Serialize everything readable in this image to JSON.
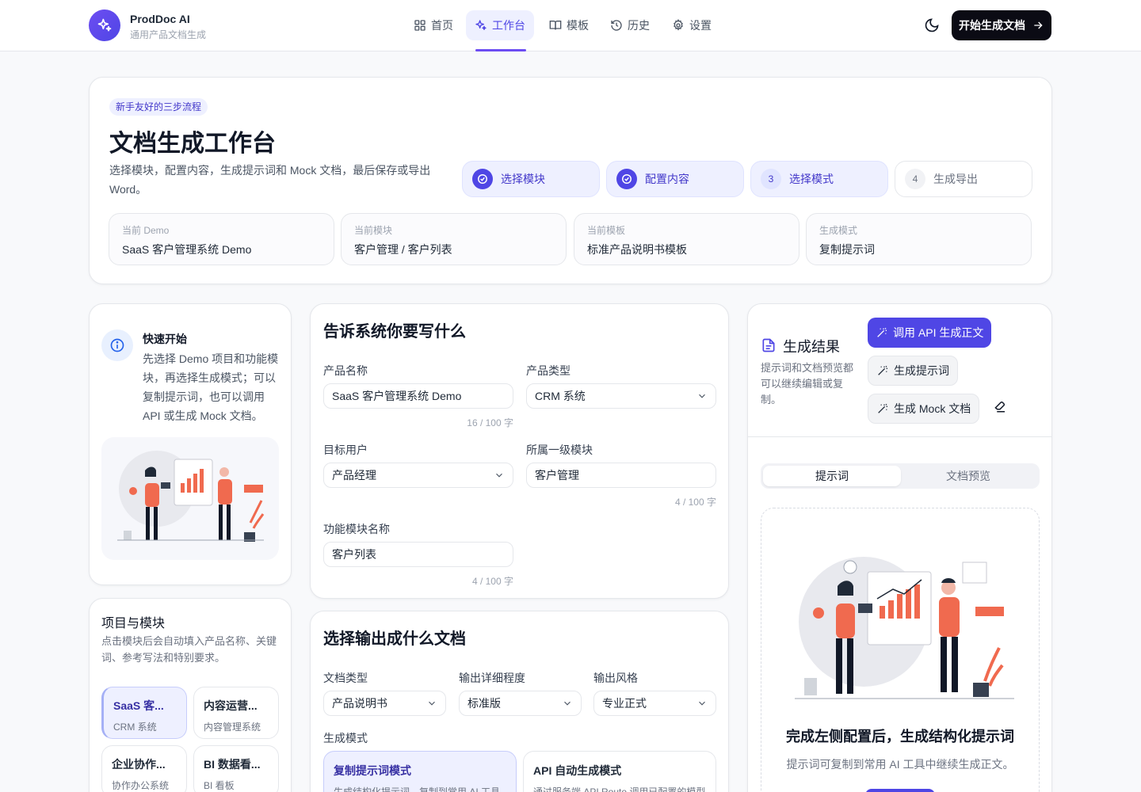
{
  "header": {
    "brand": "ProdDoc AI",
    "brand_sub": "通用产品文档生成",
    "nav": [
      {
        "label": "首页",
        "icon": "grid-icon"
      },
      {
        "label": "工作台",
        "icon": "sparkles-icon",
        "active": true
      },
      {
        "label": "模板",
        "icon": "book-icon"
      },
      {
        "label": "历史",
        "icon": "history-icon"
      },
      {
        "label": "设置",
        "icon": "gear-icon"
      }
    ],
    "cta": "开始生成文档"
  },
  "hero": {
    "badge": "新手友好的三步流程",
    "title": "文档生成工作台",
    "desc": "选择模块，配置内容，生成提示词和 Mock 文档，最后保存或导出 Word。",
    "steps": [
      {
        "label": "选择模块",
        "state": "done"
      },
      {
        "label": "配置内容",
        "state": "done"
      },
      {
        "num": "3",
        "label": "选择模式",
        "state": "current"
      },
      {
        "num": "4",
        "label": "生成导出",
        "state": "todo"
      }
    ],
    "info": [
      {
        "k": "当前 Demo",
        "v": "SaaS 客户管理系统 Demo"
      },
      {
        "k": "当前模块",
        "v": "客户管理 / 客户列表"
      },
      {
        "k": "当前模板",
        "v": "标准产品说明书模板"
      },
      {
        "k": "生成模式",
        "v": "复制提示词"
      }
    ]
  },
  "quick": {
    "title": "快速开始",
    "body": "先选择 Demo 项目和功能模块，再选择生成模式；可以复制提示词，也可以调用 API 或生成 Mock 文档。"
  },
  "projects": {
    "title": "项目与模块",
    "desc": "点击模块后会自动填入产品名称、关键词、参考写法和特别要求。",
    "items": [
      {
        "t": "SaaS 客...",
        "s": "CRM 系统",
        "selected": true
      },
      {
        "t": "内容运营...",
        "s": "内容管理系统"
      },
      {
        "t": "企业协作...",
        "s": "协作办公系统"
      },
      {
        "t": "BI 数据看...",
        "s": "BI 看板"
      }
    ]
  },
  "form": {
    "title": "告诉系统你要写什么",
    "product_name_label": "产品名称",
    "product_name": "SaaS 客户管理系统 Demo",
    "product_name_count": "16 / 100 字",
    "product_type_label": "产品类型",
    "product_type": "CRM 系统",
    "target_user_label": "目标用户",
    "target_user": "产品经理",
    "module_label": "所属一级模块",
    "module": "客户管理",
    "module_count": "4 / 100 字",
    "feature_label": "功能模块名称",
    "feature": "客户列表",
    "feature_count": "4 / 100 字"
  },
  "output": {
    "title": "选择输出成什么文档",
    "doc_type_label": "文档类型",
    "doc_type": "产品说明书",
    "detail_label": "输出详细程度",
    "detail": "标准版",
    "style_label": "输出风格",
    "style": "专业正式",
    "mode_label": "生成模式",
    "modes": [
      {
        "t": "复制提示词模式",
        "s": "生成结构化提示词，复制到常用 AI 工具",
        "selected": true
      },
      {
        "t": "API 自动生成模式",
        "s": "通过服务端 API Route 调用已配置的模型"
      }
    ]
  },
  "result": {
    "title": "生成结果",
    "desc": "提示词和文档预览都可以继续编辑或复制。",
    "btn_api": "调用 API 生成正文",
    "btn_prompt": "生成提示词",
    "btn_mock": "生成 Mock 文档",
    "tabs": [
      "提示词",
      "文档预览"
    ],
    "empty_title": "完成左侧配置后，生成结构化提示词",
    "empty_desc": "提示词可复制到常用 AI 工具中继续生成正文。"
  },
  "colors": {
    "accent": "#4f46e5",
    "illustration": "#f06a4f"
  }
}
